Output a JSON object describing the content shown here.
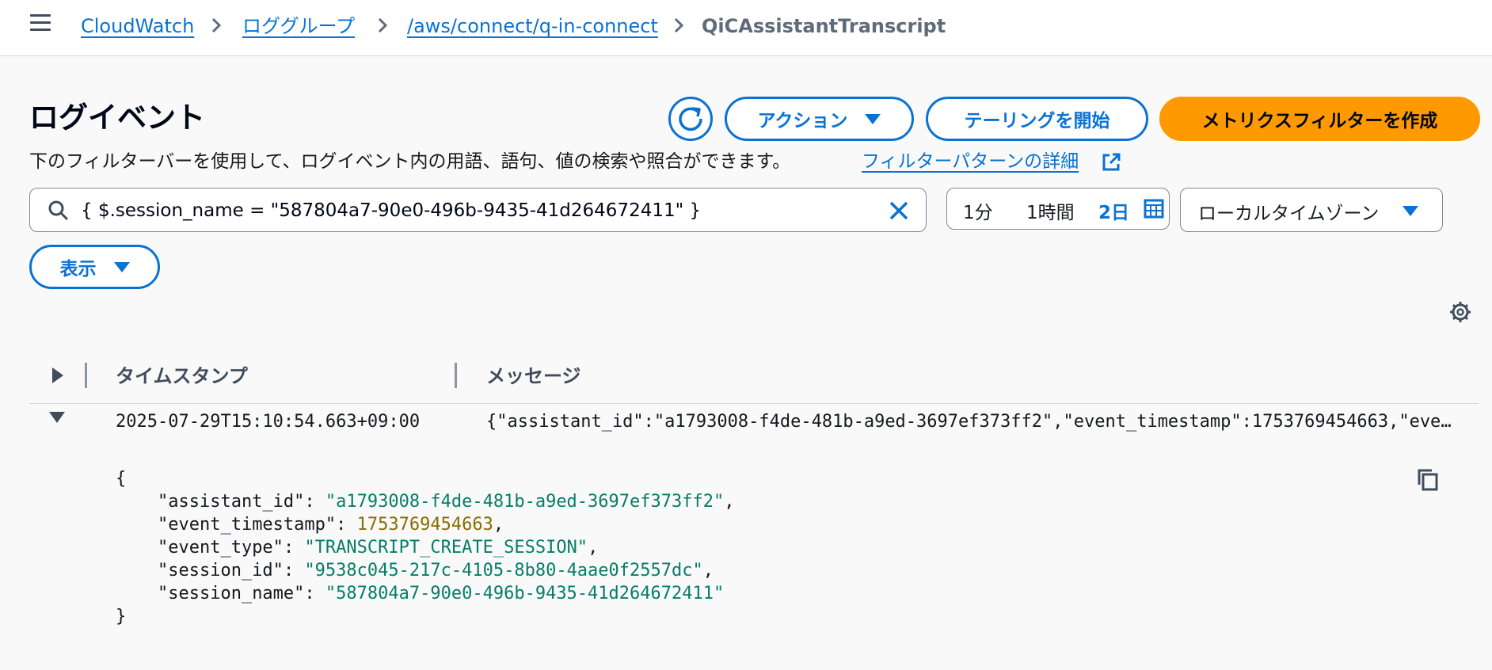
{
  "breadcrumb": {
    "items": [
      "CloudWatch",
      "ロググループ",
      "/aws/connect/q-in-connect"
    ],
    "current": "QiCAssistantTranscript"
  },
  "page": {
    "title": "ログイベント",
    "description": "下のフィルターバーを使用して、ログイベント内の用語、語句、値の検索や照合ができます。",
    "description_link": "フィルターパターンの詳細"
  },
  "actions": {
    "action_label": "アクション",
    "tailing_label": "テーリングを開始",
    "create_metric_filter_label": "メトリクスフィルターを作成"
  },
  "filter": {
    "value": "{ $.session_name = \"587804a7-90e0-496b-9435-41d264672411\" }"
  },
  "time_range": {
    "options": [
      "1分",
      "1時間",
      "2日"
    ],
    "selected": "2日"
  },
  "timezone": {
    "selected": "ローカルタイムゾーン"
  },
  "display": {
    "label": "表示"
  },
  "table": {
    "headers": [
      "タイムスタンプ",
      "メッセージ"
    ],
    "rows": [
      {
        "timestamp": "2025-07-29T15:10:54.663+09:00",
        "message": "{\"assistant_id\":\"a1793008-f4de-481b-a9ed-3697ef373ff2\",\"event_timestamp\":1753769454663,\"event_type\":\"TRANSCRIPT_CREATE_SESSION\",\"session_id\":\"9538c045-217c-4105-8b80-4aae0f2557dc\",\"session_name\":\"587804a7-90e0-496b-9435-41d264672411\"}",
        "expanded": {
          "open_brace": "{",
          "close_brace": "}",
          "fields": [
            {
              "key": "\"assistant_id\"",
              "value": "\"a1793008-f4de-481b-a9ed-3697ef373ff2\"",
              "type": "string",
              "comma": ","
            },
            {
              "key": "\"event_timestamp\"",
              "value": "1753769454663",
              "type": "number",
              "comma": ","
            },
            {
              "key": "\"event_type\"",
              "value": "\"TRANSCRIPT_CREATE_SESSION\"",
              "type": "string",
              "comma": ","
            },
            {
              "key": "\"session_id\"",
              "value": "\"9538c045-217c-4105-8b80-4aae0f2557dc\"",
              "type": "string",
              "comma": ","
            },
            {
              "key": "\"session_name\"",
              "value": "\"587804a7-90e0-496b-9435-41d264672411\"",
              "type": "string",
              "comma": ""
            }
          ]
        }
      }
    ]
  },
  "icons": [
    "menu-icon",
    "chevron-right-icon",
    "refresh-icon",
    "external-link-icon",
    "search-icon",
    "close-icon",
    "calendar-icon",
    "caret-down-icon",
    "gear-icon",
    "caret-right-icon",
    "copy-icon"
  ],
  "colors": {
    "link": "#0972d3",
    "primary": "#ff9900",
    "json_string": "#067d68",
    "json_number": "#8a6d00"
  }
}
